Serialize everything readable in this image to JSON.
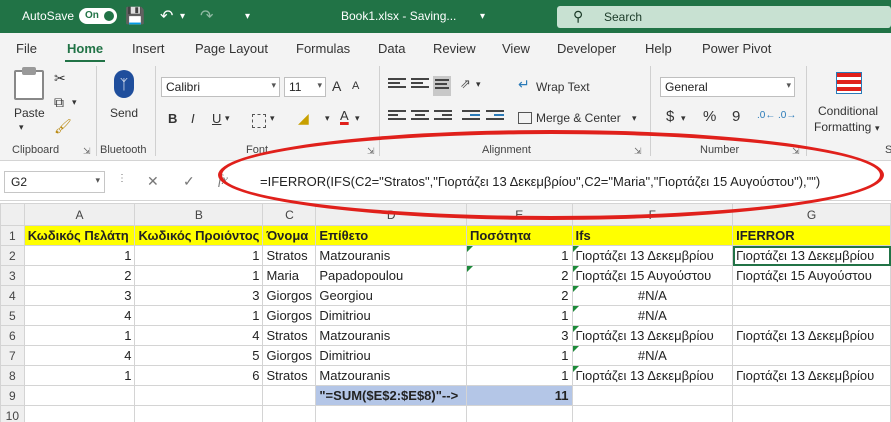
{
  "titlebar": {
    "autosave_label": "AutoSave",
    "autosave_state": "On",
    "filename": "Book1.xlsx - Saving...",
    "search_placeholder": "Search"
  },
  "menu": [
    "File",
    "Home",
    "Insert",
    "Page Layout",
    "Formulas",
    "Data",
    "Review",
    "View",
    "Developer",
    "Help",
    "Power Pivot"
  ],
  "menu_active": "Home",
  "ribbon": {
    "clipboard": {
      "paste": "Paste",
      "label": "Clipboard"
    },
    "bluetooth": {
      "send": "Send",
      "label": "Bluetooth"
    },
    "font": {
      "name": "Calibri",
      "size": "11",
      "label": "Font",
      "bold": "B",
      "italic": "I",
      "underline": "U",
      "grow": "A",
      "shrink": "A"
    },
    "alignment": {
      "wrap": "Wrap Text",
      "merge": "Merge & Center",
      "label": "Alignment"
    },
    "number": {
      "format": "General",
      "currency": "$",
      "percent": "%",
      "comma": "9",
      "label": "Number"
    },
    "styles": {
      "conditional": "Conditional",
      "formatting": "Formatting"
    }
  },
  "formula_bar": {
    "name_box": "G2",
    "formula": "=IFERROR(IFS(C2=\"Stratos\",\"Γιορτάζει 13 Δεκεμβρίου\",C2=\"Maria\",\"Γιορτάζει 15 Αυγούστου\"),\"\")"
  },
  "sheet": {
    "columns": [
      "A",
      "B",
      "C",
      "D",
      "E",
      "F",
      "G"
    ],
    "header_row": [
      "Κωδικός Πελάτη",
      "Κωδικός Προιόντος",
      "Όνομα",
      "Επίθετο",
      "Ποσότητα",
      "Ifs",
      "IFERROR"
    ],
    "rows": [
      [
        "1",
        "1",
        "Stratos",
        "Matzouranis",
        "1",
        "Γιορτάζει 13 Δεκεμβρίου",
        "Γιορτάζει 13 Δεκεμβρίου"
      ],
      [
        "2",
        "1",
        "Maria",
        "Papadopoulou",
        "2",
        "Γιορτάζει 15 Αυγούστου",
        "Γιορτάζει 15 Αυγούστου"
      ],
      [
        "3",
        "3",
        "Giorgos",
        "Georgiou",
        "2",
        "#N/A",
        ""
      ],
      [
        "4",
        "1",
        "Giorgos",
        "Dimitriou",
        "1",
        "#N/A",
        ""
      ],
      [
        "1",
        "4",
        "Stratos",
        "Matzouranis",
        "3",
        "Γιορτάζει 13 Δεκεμβρίου",
        "Γιορτάζει 13 Δεκεμβρίου"
      ],
      [
        "4",
        "5",
        "Giorgos",
        "Dimitriou",
        "1",
        "#N/A",
        ""
      ],
      [
        "1",
        "6",
        "Stratos",
        "Matzouranis",
        "1",
        "Γιορτάζει 13 Δεκεμβρίου",
        "Γιορτάζει 13 Δεκεμβρίου"
      ]
    ],
    "sum_label": "\"=SUM($E$2:$E$8)\"-->",
    "sum_value": "11",
    "row_numbers": [
      "1",
      "2",
      "3",
      "4",
      "5",
      "6",
      "7",
      "8",
      "9",
      "10"
    ]
  },
  "colors": {
    "excel_green": "#217346",
    "header_yellow": "#ffff00",
    "sum_blue": "#b4c6e7",
    "annotation_red": "#e0201b"
  }
}
